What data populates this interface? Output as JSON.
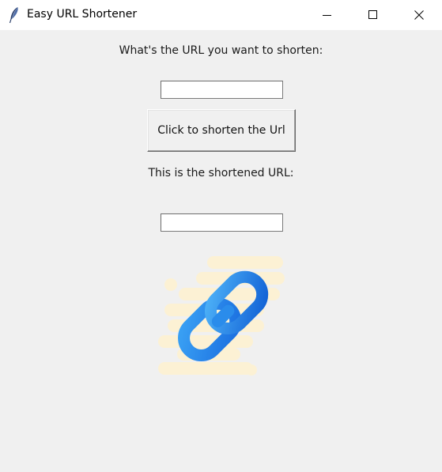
{
  "window": {
    "title": "Easy URL Shortener",
    "app_icon": "feather-icon",
    "controls": [
      "minimize-icon",
      "maximize-icon",
      "close-icon"
    ]
  },
  "main": {
    "prompt_label": "What's the URL you want to shorten:",
    "url_input": {
      "value": "",
      "placeholder": ""
    },
    "shorten_button_label": "Click to shorten the Url",
    "result_label": "This is the shortened URL:",
    "short_url_output": {
      "value": "",
      "placeholder": ""
    },
    "illustration": "chain-link-icon"
  },
  "colors": {
    "link_blue_light": "#3fa3f2",
    "link_blue_dark": "#1565d8",
    "blob_background": "#fcf1d4"
  }
}
